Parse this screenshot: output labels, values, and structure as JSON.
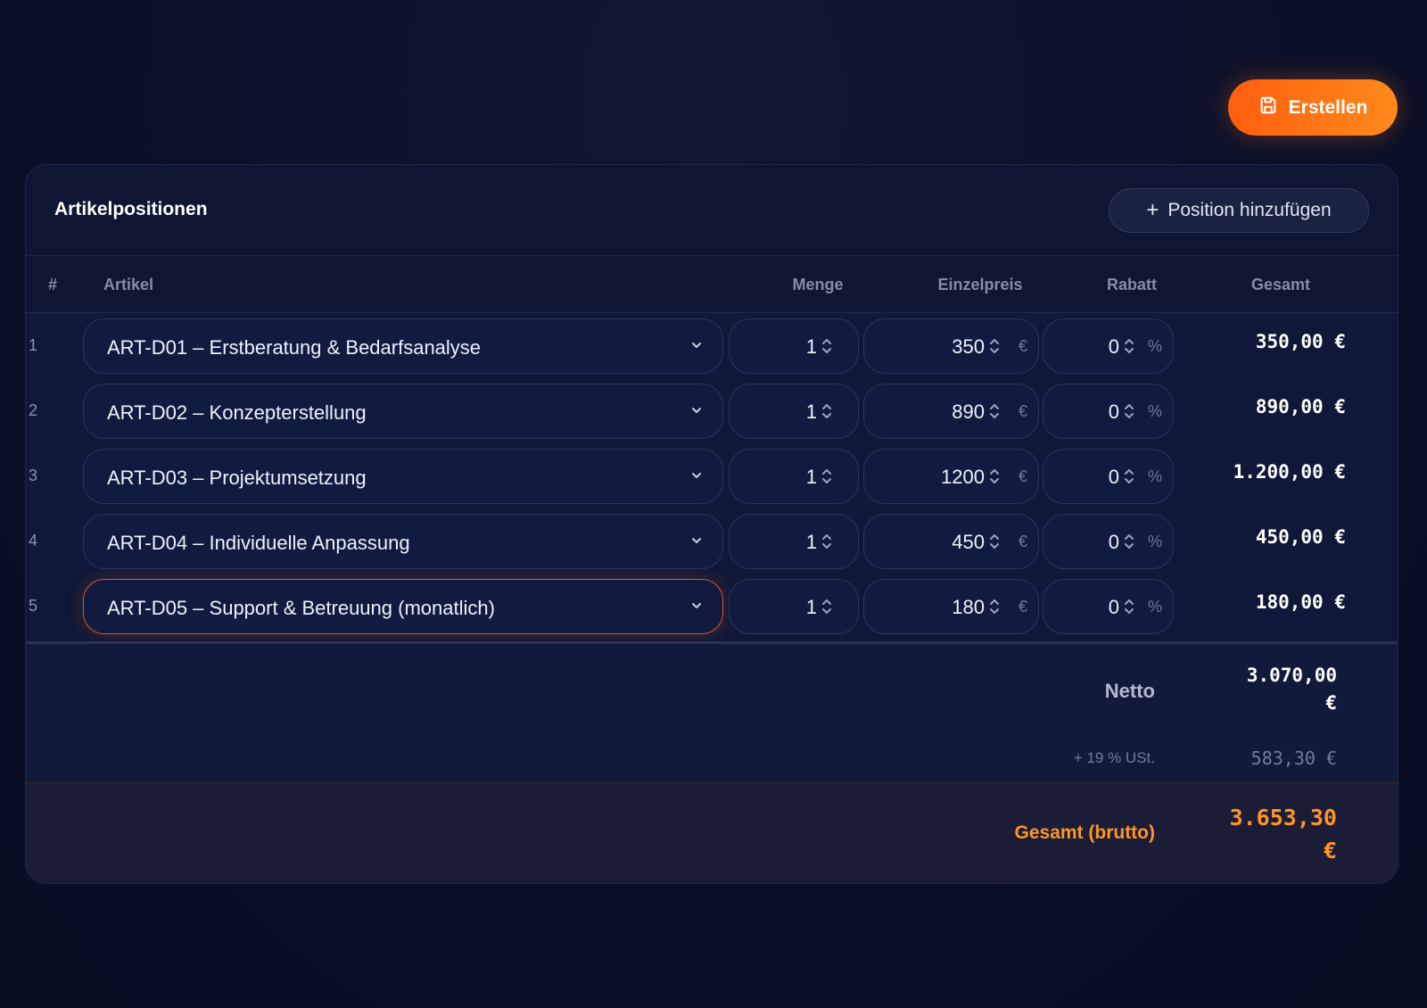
{
  "toolbar": {
    "create_label": "Erstellen",
    "create_icon": "save-icon"
  },
  "card": {
    "title": "Artikelpositionen",
    "add_label": "Position hinzufügen",
    "add_icon": "plus-icon"
  },
  "columns": {
    "num": "#",
    "article": "Artikel",
    "quantity": "Menge",
    "unit_price": "Einzelpreis",
    "discount": "Rabatt",
    "total": "Gesamt"
  },
  "rows": [
    {
      "num": "1",
      "article": "ART-D01 – Erstberatung & Bedarfsanalyse",
      "quantity": "1",
      "unit_price": "350",
      "price_unit": "€",
      "discount": "0",
      "discount_unit": "%",
      "total": "350,00 €"
    },
    {
      "num": "2",
      "article": "ART-D02 – Konzepterstellung",
      "quantity": "1",
      "unit_price": "890",
      "price_unit": "€",
      "discount": "0",
      "discount_unit": "%",
      "total": "890,00 €"
    },
    {
      "num": "3",
      "article": "ART-D03 – Projektumsetzung",
      "quantity": "1",
      "unit_price": "1200",
      "price_unit": "€",
      "discount": "0",
      "discount_unit": "%",
      "total": "1.200,00 €"
    },
    {
      "num": "4",
      "article": "ART-D04 – Individuelle Anpassung",
      "quantity": "1",
      "unit_price": "450",
      "price_unit": "€",
      "discount": "0",
      "discount_unit": "%",
      "total": "450,00 €"
    },
    {
      "num": "5",
      "article": "ART-D05 – Support & Betreuung (monatlich)",
      "quantity": "1",
      "unit_price": "180",
      "price_unit": "€",
      "discount": "0",
      "discount_unit": "%",
      "total": "180,00 €"
    }
  ],
  "summary": {
    "net_label": "Netto",
    "net_value_line1": "3.070,00",
    "net_value_line2": "€",
    "vat_label": "+ 19 % USt.",
    "vat_value": "583,30 €",
    "gross_label": "Gesamt (brutto)",
    "gross_value_line1": "3.653,30",
    "gross_value_line2": "€"
  },
  "colors": {
    "accent": "#ff7a18",
    "background": "#0b1028",
    "card": "#0f1633",
    "active_border": "#d9552a"
  }
}
